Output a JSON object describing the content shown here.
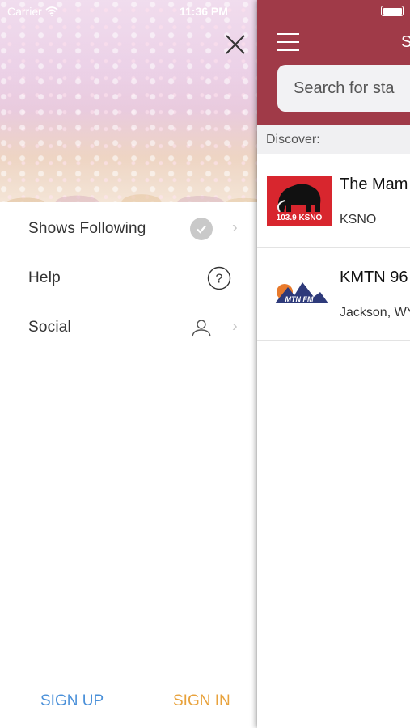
{
  "status_bar": {
    "carrier": "Carrier",
    "time": "11:36 PM"
  },
  "drawer": {
    "menu": [
      {
        "label": "Shows Following",
        "icon": "check-circle-icon",
        "has_chevron": true
      },
      {
        "label": "Help",
        "icon": "question-circle-icon",
        "has_chevron": false
      },
      {
        "label": "Social",
        "icon": "person-icon",
        "has_chevron": true
      }
    ],
    "sign_up_label": "SIGN UP",
    "sign_in_label": "SIGN IN"
  },
  "main": {
    "title_partial": "S",
    "search": {
      "placeholder": "Search for sta"
    },
    "section_label": "Discover:",
    "stations": [
      {
        "name": "The Mam",
        "subtitle": "KSNO",
        "logo_text": "103.9 KSNO"
      },
      {
        "name": "KMTN 96",
        "subtitle": "Jackson, WY",
        "logo_text": "MTN FM"
      }
    ]
  },
  "colors": {
    "header_bg": "#a03a48",
    "sign_up": "#4a90d9",
    "sign_in": "#e8a23c",
    "ksno_red": "#d8262e",
    "kmtn_navy": "#2e3a7a"
  }
}
